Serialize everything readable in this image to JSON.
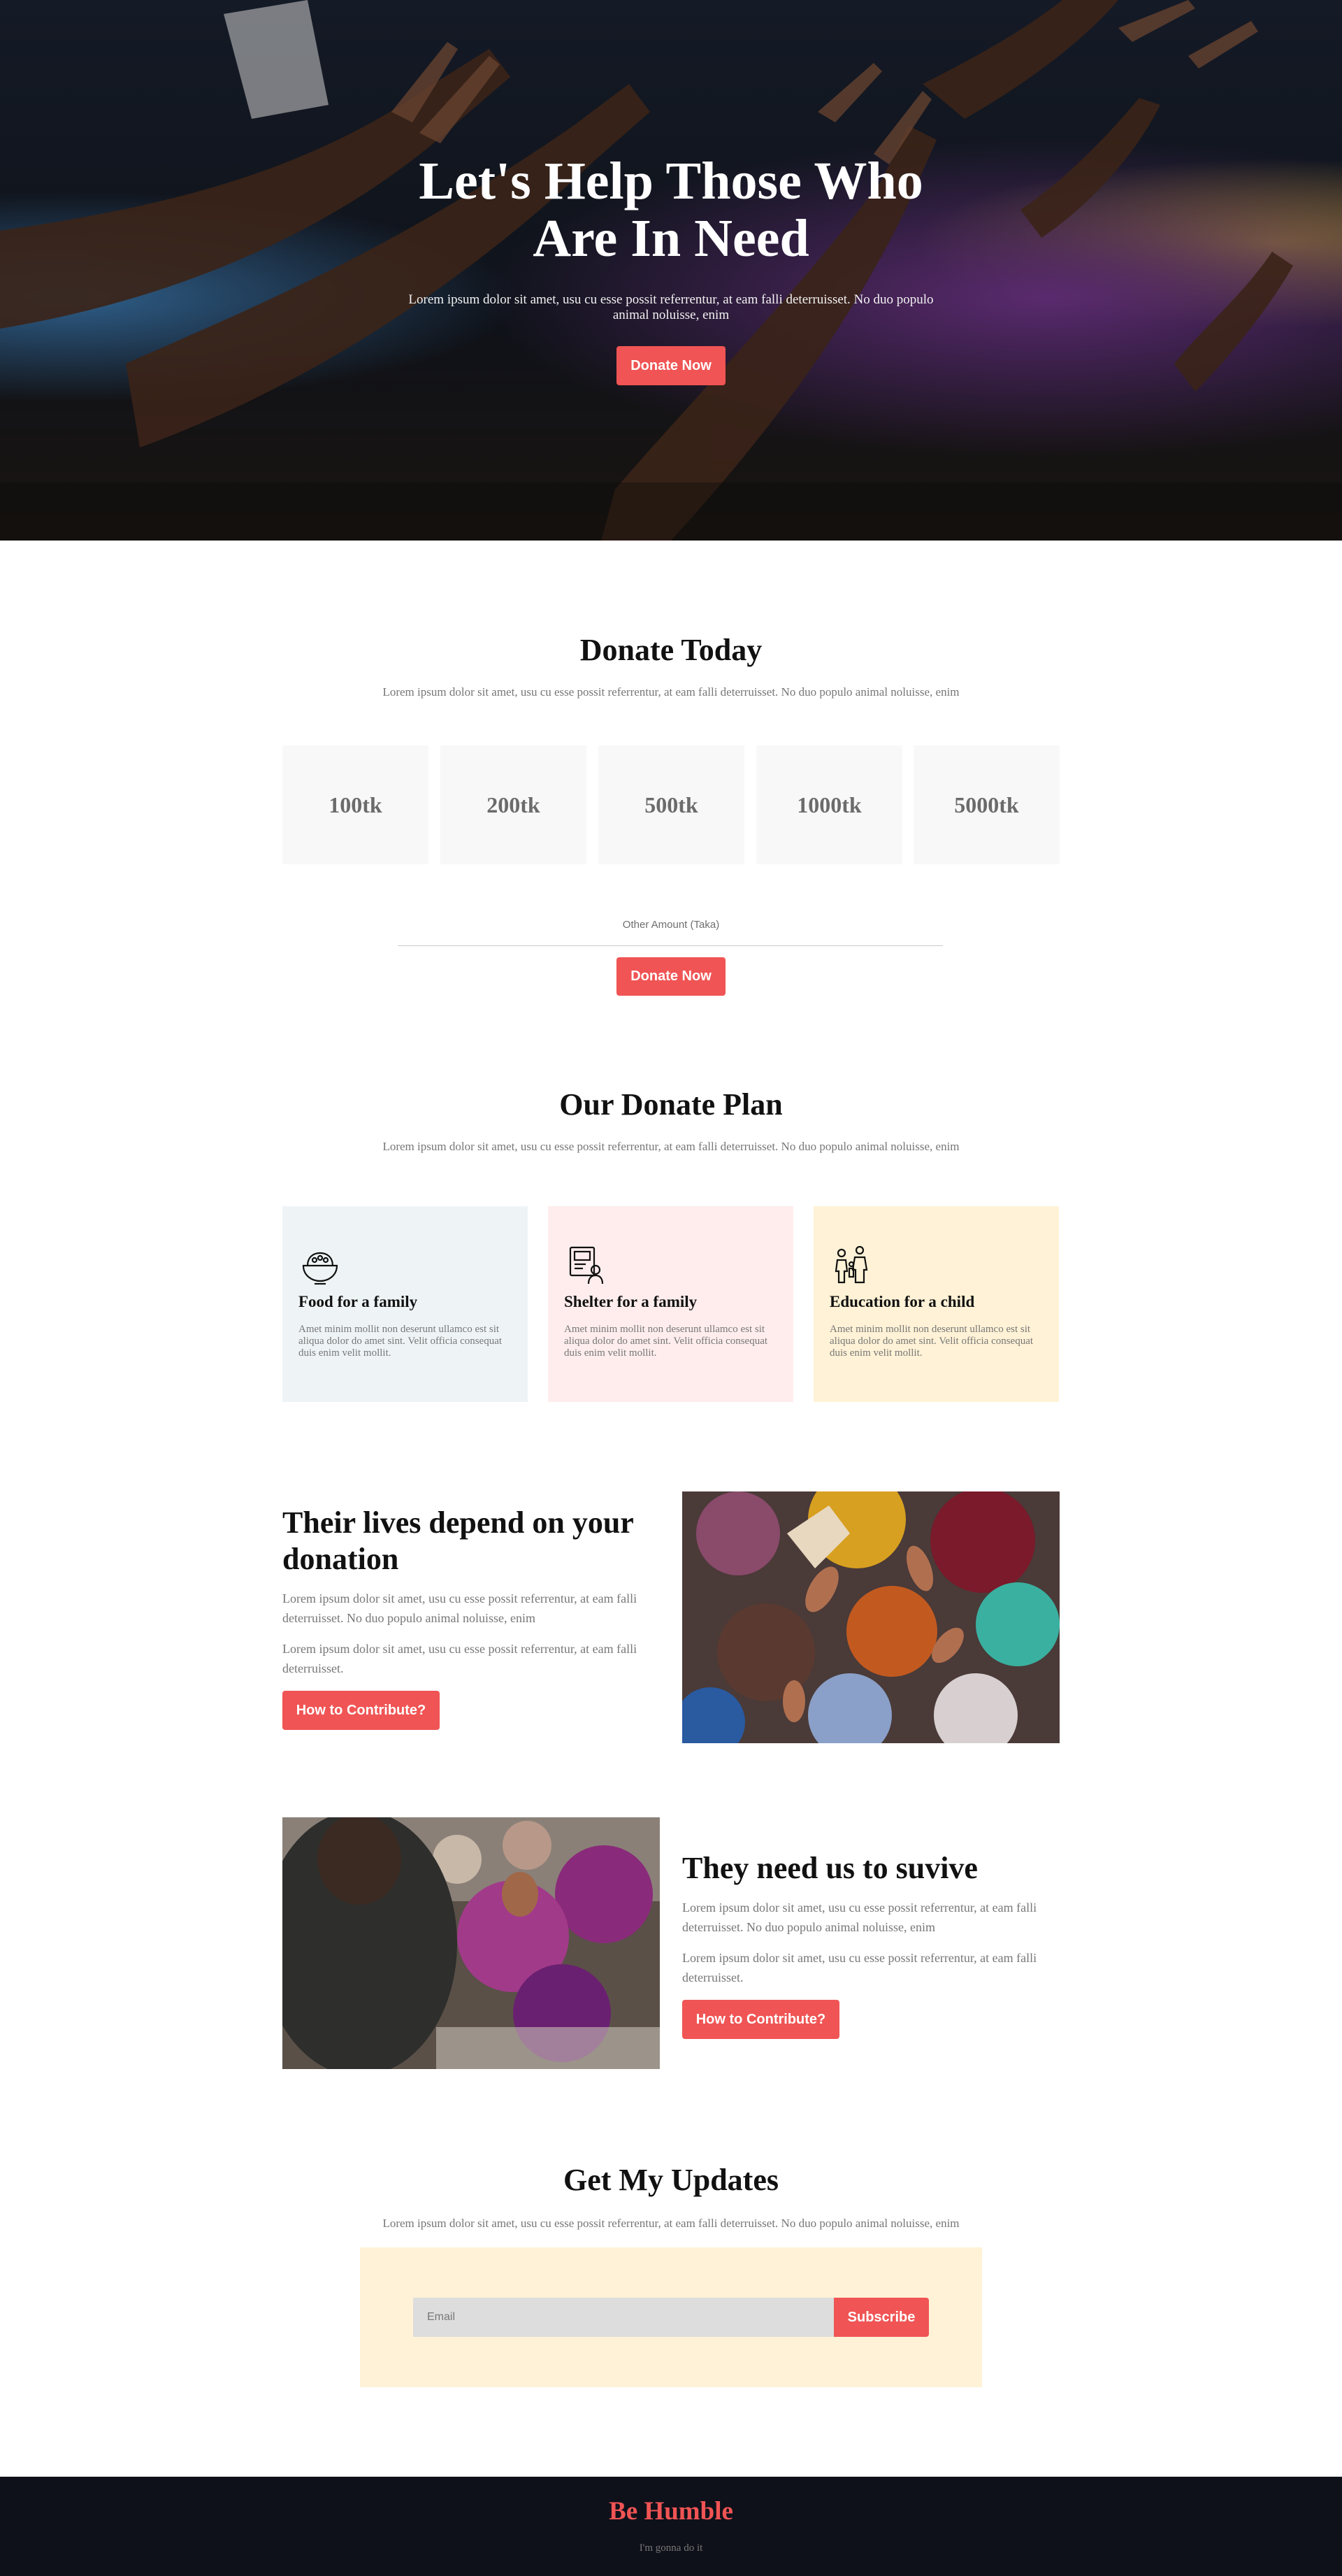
{
  "hero": {
    "title_line1": "Let's Help Those Who",
    "title_line2": "Are In Need",
    "text": "Lorem ipsum dolor sit amet, usu cu esse possit referrentur, at eam falli deterruisset. No duo populo animal noluisse, enim",
    "button": "Donate Now"
  },
  "donate": {
    "title": "Donate Today",
    "subtitle": "Lorem ipsum dolor sit amet, usu cu esse possit referrentur, at eam falli deterruisset. No duo populo animal noluisse, enim",
    "amounts": [
      "100tk",
      "200tk",
      "500tk",
      "1000tk",
      "5000tk"
    ],
    "other_label": "Other Amount (Taka)",
    "button": "Donate Now"
  },
  "plan": {
    "title": "Our Donate Plan",
    "subtitle": "Lorem ipsum dolor sit amet, usu cu esse possit referrentur, at eam falli deterruisset. No duo populo animal noluisse, enim",
    "cards": [
      {
        "title": "Food for a family",
        "text": "Amet minim mollit non deserunt ullamco est sit aliqua dolor do amet sint. Velit officia consequat duis enim velit mollit.",
        "icon": "food-bowl-icon",
        "bg": "#eef4f6"
      },
      {
        "title": "Shelter for a family",
        "text": "Amet minim mollit non deserunt ullamco est sit aliqua dolor do amet sint. Velit officia consequat duis enim velit mollit.",
        "icon": "shelter-icon",
        "bg": "#ffeded"
      },
      {
        "title": "Education for a child",
        "text": "Amet minim mollit non deserunt ullamco est sit aliqua dolor do amet sint. Velit officia consequat duis enim velit mollit.",
        "icon": "family-icon",
        "bg": "#fff2d6"
      }
    ]
  },
  "feature1": {
    "title": "Their lives depend on your donation",
    "p1": "Lorem ipsum dolor sit amet, usu cu esse possit referrentur, at eam falli deterruisset. No duo populo animal noluisse, enim",
    "p2": "Lorem ipsum dolor sit amet, usu cu esse possit referrentur, at eam falli deterruisset.",
    "button": "How to Contribute?"
  },
  "feature2": {
    "title": "They need us to suvive",
    "p1": "Lorem ipsum dolor sit amet, usu cu esse possit referrentur, at eam falli deterruisset. No duo populo animal noluisse, enim",
    "p2": "Lorem ipsum dolor sit amet, usu cu esse possit referrentur, at eam falli deterruisset.",
    "button": "How to Contribute?"
  },
  "updates": {
    "title": "Get My Updates",
    "subtitle": "Lorem ipsum dolor sit amet, usu cu esse possit referrentur, at eam falli deterruisset. No duo populo animal noluisse, enim",
    "email_placeholder": "Email",
    "button": "Subscribe"
  },
  "footer": {
    "brand": "Be Humble",
    "tagline": "I'm gonna do it"
  },
  "colors": {
    "accent": "#f05454",
    "dark": "#0f111a",
    "cream": "#fff2d6",
    "pink": "#ffeded",
    "light_blue": "#eef4f6"
  }
}
